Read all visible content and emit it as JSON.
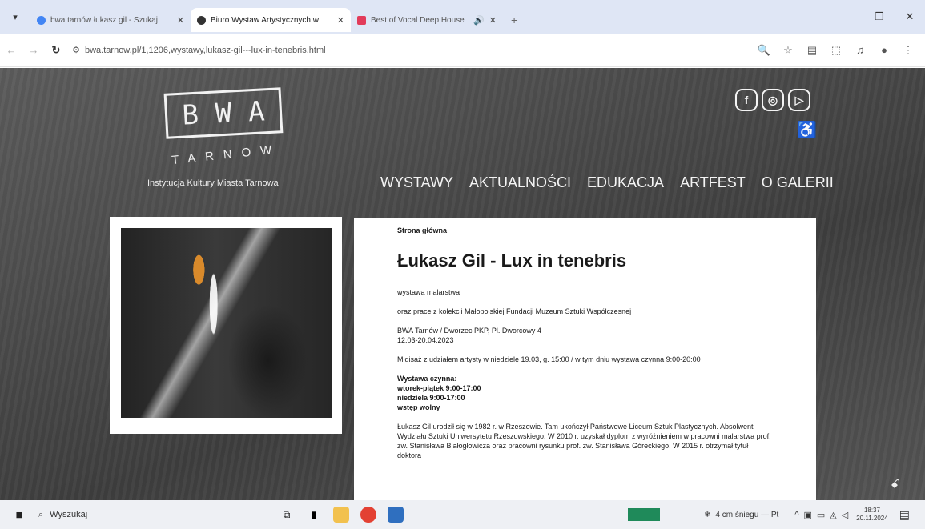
{
  "browser": {
    "tabs": [
      {
        "title": "bwa tarnów łukasz gil - Szukaj",
        "active": false,
        "favicon_color": "#4285f4"
      },
      {
        "title": "Biuro Wystaw Artystycznych w",
        "active": true,
        "favicon_color": "#333333"
      },
      {
        "title": "Best of Vocal Deep House",
        "active": false,
        "favicon_color": "#e23b5a"
      }
    ],
    "url": "bwa.tarnow.pl/1,1206,wystawy,lukasz-gil---lux-in-tenebris.html"
  },
  "site": {
    "logo": {
      "letters": [
        "B",
        "W",
        "A"
      ],
      "city": "TARNOW",
      "subtitle": "Instytucja Kultury Miasta Tarnowa"
    },
    "social": [
      "facebook-icon",
      "instagram-icon",
      "youtube-icon"
    ],
    "nav": [
      "WYSTAWY",
      "AKTUALNOŚCI",
      "EDUKACJA",
      "ARTFEST",
      "O GALERII"
    ]
  },
  "article": {
    "breadcrumb": "Strona główna",
    "title": "Łukasz Gil - Lux in tenebris",
    "subtitle": "wystawa malarstwa",
    "collection": "oraz prace z kolekcji Małopolskiej Fundacji Muzeum Sztuki Współczesnej",
    "venue": "BWA Tarnów / Dworzec PKP, Pl. Dworcowy 4",
    "dates": "12.03-20.04.2023",
    "finissage": "Midisaż z udziałem artysty w niedzielę 19.03, g. 15:00 / w tym dniu wystawa czynna 9:00-20:00",
    "hours_title": "Wystawa czynna:",
    "hours_weekdays": "wtorek-piątek 9:00-17:00",
    "hours_sunday": "niedziela 9:00-17:00",
    "entry": "wstęp wolny",
    "bio": "Łukasz Gil urodził się w 1982 r. w Rzeszowie. Tam ukończył Państwowe Liceum Sztuk Plastycznych. Absolwent Wydziału Sztuki Uniwersytetu Rzeszowskiego. W 2010 r. uzyskał dyplom z wyróżnieniem w pracowni malarstwa prof. zw. Stanisława Białogłowicza oraz pracowni rysunku prof. zw. Stanisława Góreckiego. W 2015 r. otrzymał tytuł doktora"
  },
  "taskbar": {
    "search_label": "Wyszukaj",
    "weather": "4 cm śniegu — Pt",
    "time": "18:37",
    "date": "20.11.2024"
  }
}
